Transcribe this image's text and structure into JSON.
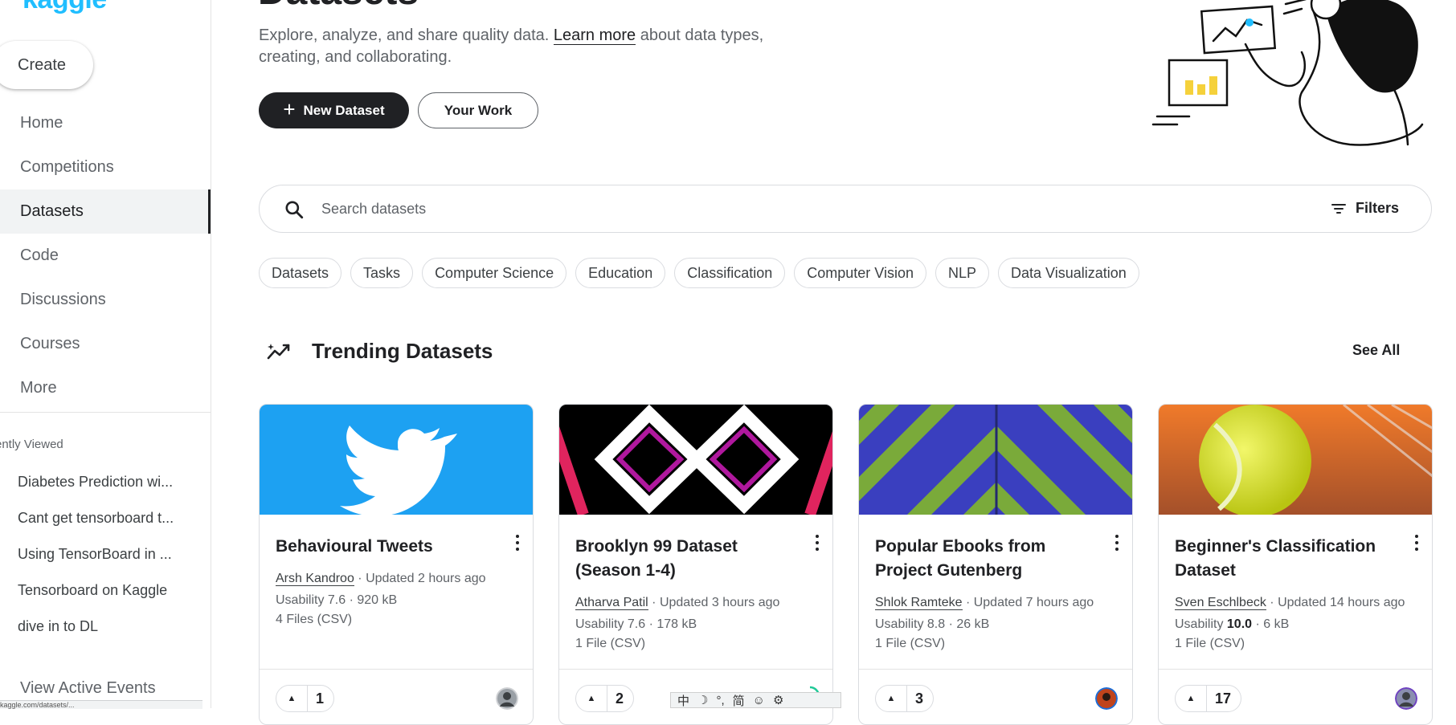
{
  "sidebar": {
    "logo": "kaggle",
    "create_label": "Create",
    "nav": [
      {
        "label": "Home",
        "active": false
      },
      {
        "label": "Competitions",
        "active": false
      },
      {
        "label": "Datasets",
        "active": true
      },
      {
        "label": "Code",
        "active": false
      },
      {
        "label": "Discussions",
        "active": false
      },
      {
        "label": "Courses",
        "active": false
      },
      {
        "label": "More",
        "active": false
      }
    ],
    "recently_viewed_title": "ently Viewed",
    "recent": [
      "Diabetes Prediction wi...",
      "Cant get tensorboard t...",
      "Using TensorBoard in ...",
      "Tensorboard on Kaggle",
      "dive in to DL"
    ],
    "view_events": "View Active Events",
    "status_url": "kaggle.com/datasets/..."
  },
  "header": {
    "title": "Datasets",
    "intro_before": "Explore, analyze, and share quality data. ",
    "intro_link": "Learn more",
    "intro_after": " about data types, creating, and collaborating.",
    "new_dataset": "New Dataset",
    "your_work": "Your Work"
  },
  "search": {
    "placeholder": "Search datasets",
    "filters": "Filters"
  },
  "chips": [
    "Datasets",
    "Tasks",
    "Computer Science",
    "Education",
    "Classification",
    "Computer Vision",
    "NLP",
    "Data Visualization"
  ],
  "trending": {
    "title": "Trending Datasets",
    "see_all": "See All",
    "cards": [
      {
        "title": "Behavioural Tweets",
        "author": "Arsh Kandroo",
        "updated": " · Updated 2 hours ago",
        "usability_label": "Usability ",
        "usability": "7.6",
        "size": " · 920 kB",
        "files": "4 Files (CSV)",
        "votes": "1",
        "usability_bold": false
      },
      {
        "title": "Brooklyn 99 Dataset (Season 1-4)",
        "author": "Atharva Patil",
        "updated": " · Updated 3 hours ago",
        "usability_label": "Usability ",
        "usability": "7.6",
        "size": " · 178 kB",
        "files": "1 File (CSV)",
        "votes": "2",
        "usability_bold": false
      },
      {
        "title": "Popular Ebooks from Project Gutenberg",
        "author": "Shlok Ramteke",
        "updated": " · Updated 7 hours ago",
        "usability_label": "Usability ",
        "usability": "8.8",
        "size": " · 26 kB",
        "files": "1 File (CSV)",
        "votes": "3",
        "usability_bold": false
      },
      {
        "title": "Beginner's Classification Dataset",
        "author": "Sven Eschlbeck",
        "updated": " · Updated 14 hours ago",
        "usability_label": "Usability ",
        "usability": "10.0",
        "size": " · 6 kB",
        "files": "1 File (CSV)",
        "votes": "17",
        "usability_bold": true
      }
    ]
  },
  "ime": [
    "中",
    "☽",
    "°,",
    "简",
    "☺",
    "⚙"
  ],
  "colors": {
    "accent": "#20beff",
    "dark": "#202124",
    "twitter": "#1da1f2",
    "tennis": "#d7e51c"
  }
}
